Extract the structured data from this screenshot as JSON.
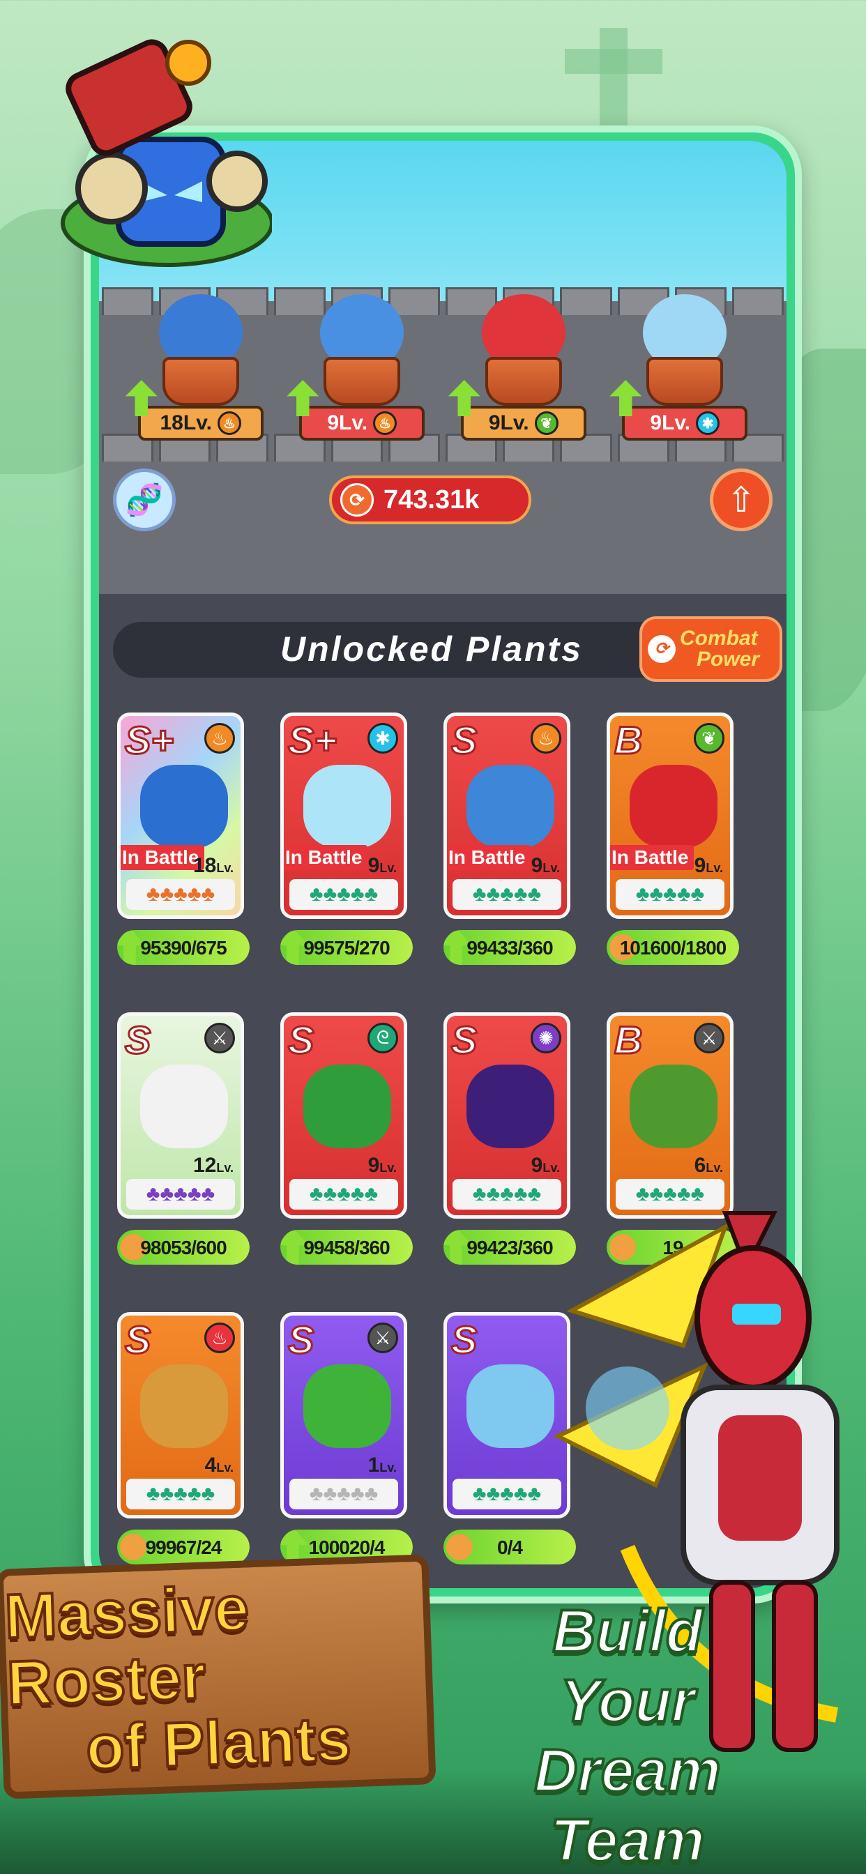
{
  "team": [
    {
      "level": "18Lv.",
      "element_icon": "fire-icon",
      "element_color": "#f08a24",
      "plant_color": "#3a7bd5",
      "tag_style": "orange"
    },
    {
      "level": "9Lv.",
      "element_icon": "fire-icon",
      "element_color": "#f08a24",
      "plant_color": "#4a90e2",
      "tag_style": "red"
    },
    {
      "level": "9Lv.",
      "element_icon": "leaf-icon",
      "element_color": "#58b82e",
      "plant_color": "#e0353a",
      "tag_style": "orange"
    },
    {
      "level": "9Lv.",
      "element_icon": "snowflake-icon",
      "element_color": "#25c2e8",
      "plant_color": "#9fd8f5",
      "tag_style": "red"
    }
  ],
  "combat_power": {
    "value": "743.31k"
  },
  "section": {
    "title": "Unlocked Plants",
    "button_line1": "Combat",
    "button_line2": "Power"
  },
  "cards": [
    {
      "grade": "S+",
      "level": "18",
      "lv_suffix": "Lv.",
      "in_battle": "In Battle",
      "shard": "95390/675",
      "shard_icon": "up",
      "bg": "rainbow",
      "element_color": "#f08a24",
      "element_glyph": "♨",
      "art_color": "#2b6fd1",
      "stars": "♣♣♣♣♣",
      "star_color": "#e8722c"
    },
    {
      "grade": "S+",
      "level": "9",
      "lv_suffix": "Lv.",
      "in_battle": "In Battle",
      "shard": "99575/270",
      "shard_icon": "up",
      "bg": "red",
      "element_color": "#25c2e8",
      "element_glyph": "✱",
      "art_color": "#aee4f7",
      "stars": "♣♣♣♣♣",
      "star_color": "#1fa877"
    },
    {
      "grade": "S",
      "level": "9",
      "lv_suffix": "Lv.",
      "in_battle": "In Battle",
      "shard": "99433/360",
      "shard_icon": "up",
      "bg": "red",
      "element_color": "#f08a24",
      "element_glyph": "♨",
      "art_color": "#3e86d8",
      "stars": "♣♣♣♣♣",
      "star_color": "#1fa877"
    },
    {
      "grade": "B",
      "level": "9",
      "lv_suffix": "Lv.",
      "in_battle": "In Battle",
      "shard": "101600/1800",
      "shard_icon": "paw",
      "bg": "orange",
      "element_color": "#58b82e",
      "element_glyph": "❦",
      "art_color": "#d9262c",
      "stars": "♣♣♣♣♣",
      "star_color": "#1fa877"
    },
    {
      "grade": "S",
      "level": "12",
      "lv_suffix": "Lv.",
      "in_battle": "",
      "shard": "98053/600",
      "shard_icon": "paw",
      "bg": "green",
      "element_color": "#555",
      "element_glyph": "⚔",
      "art_color": "#f2f2f2",
      "stars": "♣♣♣♣♣",
      "star_color": "#7b3fc4"
    },
    {
      "grade": "S",
      "level": "9",
      "lv_suffix": "Lv.",
      "in_battle": "",
      "shard": "99458/360",
      "shard_icon": "up",
      "bg": "red",
      "element_color": "#1fa877",
      "element_glyph": "ᘓ",
      "art_color": "#2f9d3b",
      "stars": "♣♣♣♣♣",
      "star_color": "#1fa877"
    },
    {
      "grade": "S",
      "level": "9",
      "lv_suffix": "Lv.",
      "in_battle": "",
      "shard": "99423/360",
      "shard_icon": "up",
      "bg": "red",
      "element_color": "#7b3fc4",
      "element_glyph": "✺",
      "art_color": "#3d1f7a",
      "stars": "♣♣♣♣♣",
      "star_color": "#1fa877"
    },
    {
      "grade": "B",
      "level": "6",
      "lv_suffix": "Lv.",
      "in_battle": "",
      "shard": "19",
      "shard_icon": "paw",
      "bg": "orange",
      "element_color": "#555",
      "element_glyph": "⚔",
      "art_color": "#4f9a2e",
      "stars": "♣♣♣♣♣",
      "star_color": "#1fa877"
    },
    {
      "grade": "S",
      "level": "4",
      "lv_suffix": "Lv.",
      "in_battle": "",
      "shard": "99967/24",
      "shard_icon": "paw",
      "bg": "orange",
      "element_color": "#e8333a",
      "element_glyph": "♨",
      "art_color": "#d89a3a",
      "stars": "♣♣♣♣♣",
      "star_color": "#1fa877"
    },
    {
      "grade": "S",
      "level": "1",
      "lv_suffix": "Lv.",
      "in_battle": "",
      "shard": "100020/4",
      "shard_icon": "up",
      "bg": "purple",
      "element_color": "#555",
      "element_glyph": "⚔",
      "art_color": "#3fb23a",
      "stars": "♣♣♣♣♣",
      "star_color": "#b5b5b5"
    },
    {
      "grade": "S",
      "level": "",
      "lv_suffix": "",
      "in_battle": "",
      "shard": "0/4",
      "shard_icon": "paw",
      "bg": "purple",
      "element_color": "#555",
      "element_glyph": "",
      "art_color": "#7fc8f0",
      "stars": "♣♣♣♣♣",
      "star_color": "#1fa877"
    }
  ],
  "banner": {
    "line1": "Massive Roster",
    "line2": "of Plants"
  },
  "tagline": {
    "line1": "Build Your",
    "line2": "Dream Team"
  }
}
